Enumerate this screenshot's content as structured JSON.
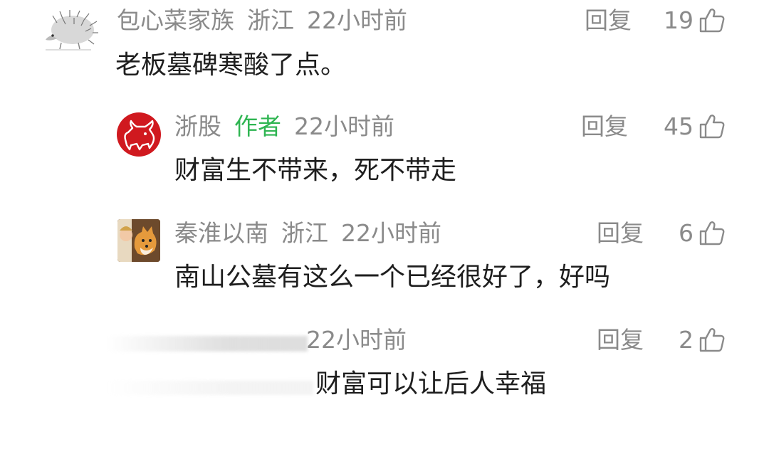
{
  "comments": [
    {
      "username": "包心菜家族",
      "location": "浙江",
      "time": "22小时前",
      "reply_label": "回复",
      "likes": "19",
      "text": "老板墓碑寒酸了点。",
      "avatar_icon": "hedgehog-icon"
    },
    {
      "username": "浙股",
      "author_tag": "作者",
      "time": "22小时前",
      "reply_label": "回复",
      "likes": "45",
      "text": "财富生不带来，死不带走",
      "avatar_icon": "bull-logo-icon",
      "avatar_color": "#d0191f"
    },
    {
      "username": "秦淮以南",
      "location": "浙江",
      "time": "22小时前",
      "reply_label": "回复",
      "likes": "6",
      "text": "南山公墓有这么一个已经很好了，好吗",
      "avatar_icon": "shiba-dog-icon"
    },
    {
      "time": "22小时前",
      "reply_label": "回复",
      "likes": "2",
      "text": "财富可以让后人幸福"
    }
  ],
  "colors": {
    "meta_gray": "#8a8a8a",
    "author_green": "#2fb552",
    "text_dark": "#1e1e1e"
  },
  "icons": {
    "like": "thumbs-up-icon"
  }
}
